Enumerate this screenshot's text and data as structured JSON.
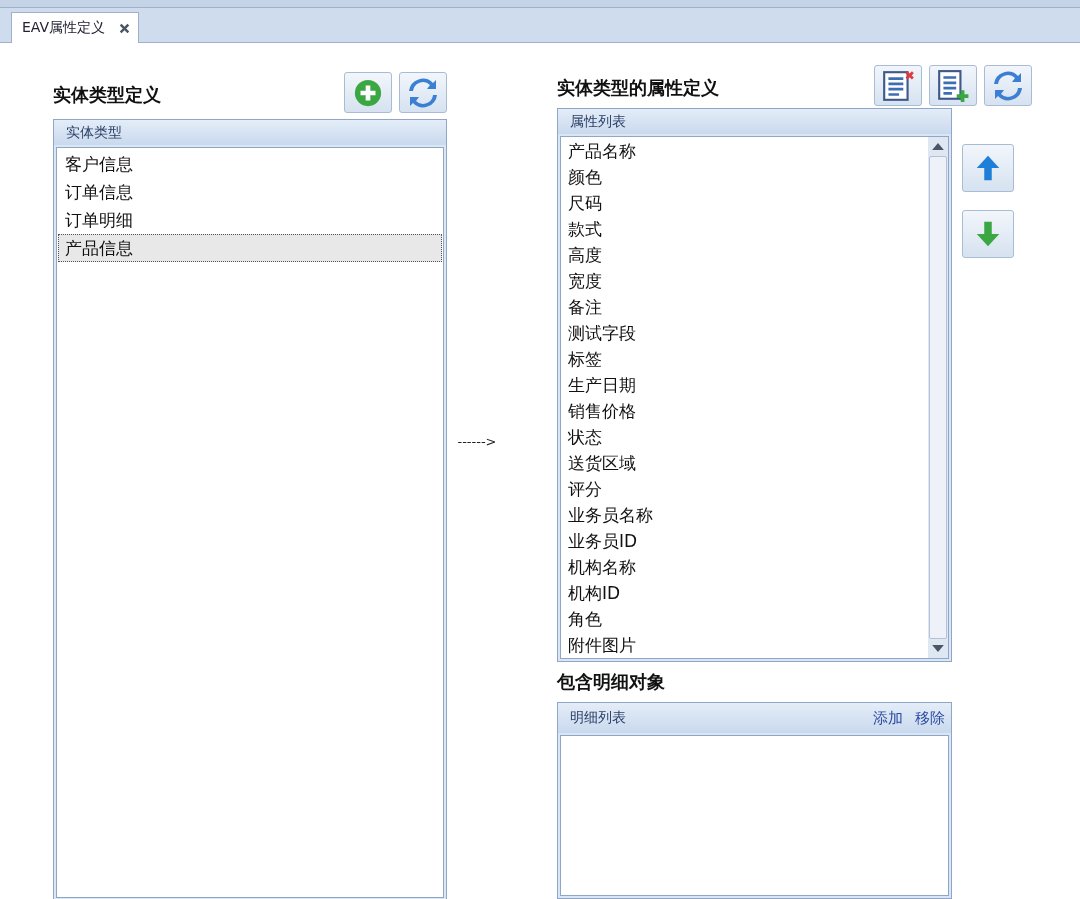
{
  "tabs": [
    {
      "label": "EAV属性定义",
      "selected": true
    }
  ],
  "entity_panel": {
    "title": "实体类型定义",
    "list": {
      "header": "实体类型",
      "items": [
        {
          "label": "客户信息",
          "selected": false
        },
        {
          "label": "订单信息",
          "selected": false
        },
        {
          "label": "订单明细",
          "selected": false
        },
        {
          "label": "产品信息",
          "selected": true
        }
      ]
    }
  },
  "connector": {
    "label": "------>"
  },
  "attribute_panel": {
    "title": "实体类型的属性定义",
    "list": {
      "header": "属性列表",
      "items": [
        "产品名称",
        "颜色",
        "尺码",
        "款式",
        "高度",
        "宽度",
        "备注",
        "测试字段",
        "标签",
        "生产日期",
        "销售价格",
        "状态",
        "送货区域",
        "评分",
        "业务员名称",
        "业务员ID",
        "机构名称",
        "机构ID",
        "角色",
        "附件图片"
      ]
    }
  },
  "detail_panel": {
    "title": "包含明细对象",
    "list": {
      "header": "明细列表",
      "actions": [
        "添加",
        "移除"
      ]
    }
  }
}
